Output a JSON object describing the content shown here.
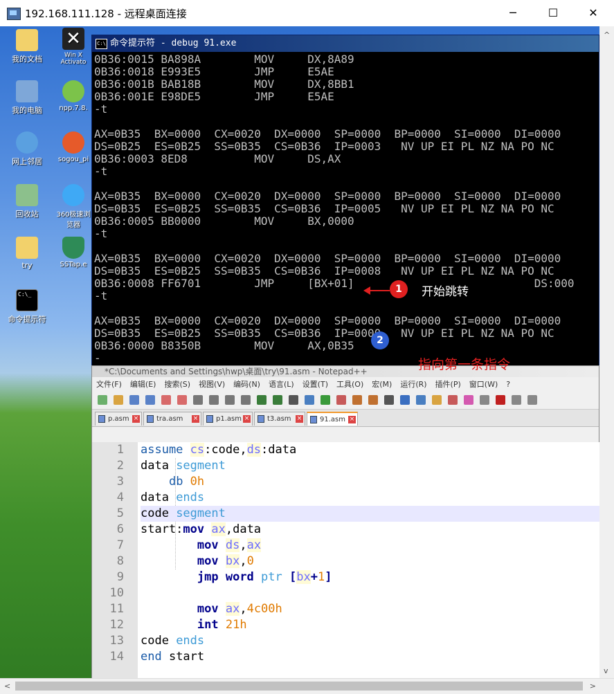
{
  "window": {
    "title": "192.168.111.128 - 远程桌面连接",
    "minimize": "─",
    "maximize": "☐",
    "close": "✕"
  },
  "desktop_icons": [
    {
      "label": "我的文档",
      "icon": "folder-docs-icon",
      "color": "#f2d16b"
    },
    {
      "label": "我的电脑",
      "icon": "computer-icon",
      "color": "#7ea7d8"
    },
    {
      "label": "网上邻居",
      "icon": "network-icon",
      "color": "#5aa0e0"
    },
    {
      "label": "回收站",
      "icon": "recycle-bin-icon",
      "color": "#8cc08c"
    },
    {
      "label": "try",
      "icon": "folder-icon",
      "color": "#f2d16b"
    },
    {
      "label": "命令提示符",
      "icon": "cmd-icon",
      "color": "#000000"
    },
    {
      "label": "Win X Activato",
      "icon": "winx-icon",
      "color": "#222222"
    },
    {
      "label": "npp.7.8.",
      "icon": "notepadpp-icon",
      "color": "#7cc34a"
    },
    {
      "label": "sogou_pi",
      "icon": "sogou-icon",
      "color": "#e65a2a"
    },
    {
      "label": "360极速浏览器",
      "icon": "browser-360-icon",
      "color": "#3fa9f5"
    },
    {
      "label": "SSTap.e",
      "icon": "shield-icon",
      "color": "#2e8b57"
    }
  ],
  "cmd": {
    "title": "命令提示符 - debug 91.exe",
    "lines": [
      "0B36:0015 BA898A        MOV     DX,8A89",
      "0B36:0018 E993E5        JMP     E5AE",
      "0B36:001B BAB18B        MOV     DX,8BB1",
      "0B36:001E E98DE5        JMP     E5AE",
      "-t",
      "",
      "AX=0B35  BX=0000  CX=0020  DX=0000  SP=0000  BP=0000  SI=0000  DI=0000",
      "DS=0B25  ES=0B25  SS=0B35  CS=0B36  IP=0003   NV UP EI PL NZ NA PO NC",
      "0B36:0003 8ED8          MOV     DS,AX",
      "-t",
      "",
      "AX=0B35  BX=0000  CX=0020  DX=0000  SP=0000  BP=0000  SI=0000  DI=0000",
      "DS=0B35  ES=0B25  SS=0B35  CS=0B36  IP=0005   NV UP EI PL NZ NA PO NC",
      "0B36:0005 BB0000        MOV     BX,0000",
      "-t",
      "",
      "AX=0B35  BX=0000  CX=0020  DX=0000  SP=0000  BP=0000  SI=0000  DI=0000",
      "DS=0B35  ES=0B25  SS=0B35  CS=0B36  IP=0008   NV UP EI PL NZ NA PO NC",
      "0B36:0008 FF6701        JMP     [BX+01]                           DS:000",
      "-t",
      "",
      "AX=0B35  BX=0000  CX=0020  DX=0000  SP=0000  BP=0000  SI=0000  DI=0000",
      "DS=0B35  ES=0B25  SS=0B35  CS=0B36  IP=0000   NV UP EI PL NZ NA PO NC",
      "0B36:0000 B8350B        MOV     AX,0B35",
      "-"
    ]
  },
  "annotations": {
    "badge1": "1",
    "text1": "开始跳转",
    "badge2": "2",
    "text2": "指向第一条指令",
    "red": "#e02020",
    "blue": "#2f5fd0"
  },
  "notepad": {
    "title": "*C:\\Documents and Settings\\hwp\\桌面\\try\\91.asm - Notepad++",
    "menu": [
      "文件(F)",
      "编辑(E)",
      "搜索(S)",
      "视图(V)",
      "编码(N)",
      "语言(L)",
      "设置(T)",
      "工具(O)",
      "宏(M)",
      "运行(R)",
      "插件(P)",
      "窗口(W)",
      "?"
    ],
    "tabs": [
      "p.asm",
      "tra.asm",
      "p1.asm",
      "t3.asm",
      "91.asm"
    ],
    "active_tab": "91.asm",
    "line_numbers": [
      "1",
      "2",
      "3",
      "4",
      "5",
      "6",
      "7",
      "8",
      "9",
      "10",
      "11",
      "12",
      "13",
      "14"
    ],
    "code": {
      "l1_a": "assume ",
      "l1_b": "cs",
      "l1_c": ":code,",
      "l1_d": "ds",
      "l1_e": ":data",
      "l2_a": "data ",
      "l2_b": "segment",
      "l3_a": "db ",
      "l3_b": "0h",
      "l4_a": "data ",
      "l4_b": "ends",
      "l5_a": "code ",
      "l5_b": "segment",
      "l6_a": "start:",
      "l6_b": "mov ",
      "l6_c": "ax",
      "l6_d": ",data",
      "l7_a": "mov ",
      "l7_b": "ds",
      "l7_c": ",",
      "l7_d": "ax",
      "l8_a": "mov ",
      "l8_b": "bx",
      "l8_c": ",",
      "l8_d": "0",
      "l9_a": "jmp ",
      "l9_b": "word ",
      "l9_c": "ptr ",
      "l9_d": "[",
      "l9_e": "bx",
      "l9_f": "+",
      "l9_g": "1",
      "l9_h": "]",
      "l11_a": "mov ",
      "l11_b": "ax",
      "l11_c": ",",
      "l11_d": "4c00h",
      "l12_a": "int ",
      "l12_b": "21h",
      "l13_a": "code ",
      "l13_b": "ends",
      "l14_a": "end ",
      "l14_b": "start"
    }
  },
  "scroll": {
    "left": "<",
    "right": ">",
    "up": "^",
    "down": "v"
  }
}
